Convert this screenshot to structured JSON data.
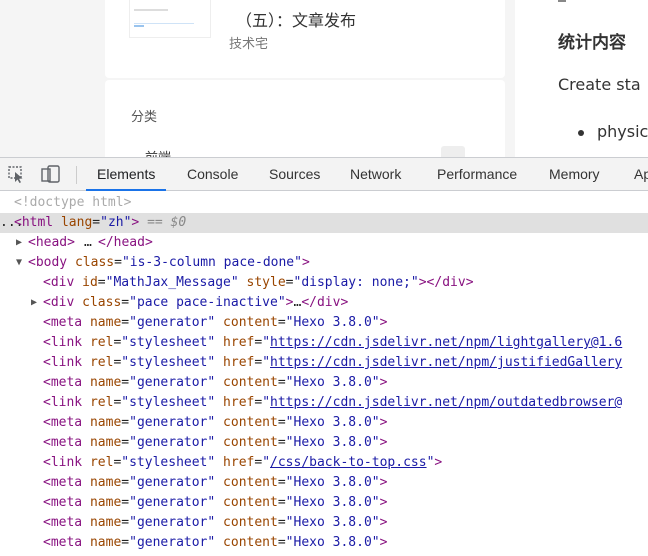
{
  "page": {
    "post": {
      "title": "（五）：文章发布",
      "category": "技术宅"
    },
    "category_card": {
      "title": "分类",
      "first_item": "前端"
    },
    "right": {
      "heading": "统计内容",
      "text": "Create sta",
      "list_item": "physic"
    }
  },
  "devtools": {
    "tabs": [
      {
        "label": "Elements",
        "active": true
      },
      {
        "label": "Console"
      },
      {
        "label": "Sources"
      },
      {
        "label": "Network"
      },
      {
        "label": "Performance"
      },
      {
        "label": "Memory"
      },
      {
        "label": "Ap"
      }
    ],
    "icons": [
      "inspect-element-icon",
      "device-toolbar-icon"
    ],
    "dom": {
      "doctype": "<!doctype html>",
      "html": {
        "tag": "html",
        "attr": "lang",
        "val": "zh",
        "ellipsis": "...",
        "marker": "== $0"
      },
      "head": {
        "open": "<head>",
        "dots": "…",
        "close": "</head>"
      },
      "body": {
        "tag": "body",
        "attr": "class",
        "val": "is-3-column  pace-done"
      },
      "div1": {
        "tag": "div",
        "a1": "id",
        "v1": "MathJax_Message",
        "a2": "style",
        "v2": "display: none;"
      },
      "div2": {
        "tag": "div",
        "a1": "class",
        "v1": "pace  pace-inactive",
        "dots": "…"
      },
      "meta_attr_name": "name",
      "meta_attr_content": "content",
      "meta_name": "generator",
      "meta_content": "Hexo 3.8.0",
      "link_attr_rel": "rel",
      "link_attr_href": "href",
      "link_rel": "stylesheet",
      "links": [
        "https://cdn.jsdelivr.net/npm/lightgallery@1.6",
        "https://cdn.jsdelivr.net/npm/justifiedGallery",
        "https://cdn.jsdelivr.net/npm/outdatedbrowser@",
        "/css/back-to-top.css"
      ]
    }
  },
  "colors": {
    "tag": "#881280",
    "attr": "#994500",
    "value": "#1a1aa6",
    "active_tab": "#1a73e8"
  }
}
